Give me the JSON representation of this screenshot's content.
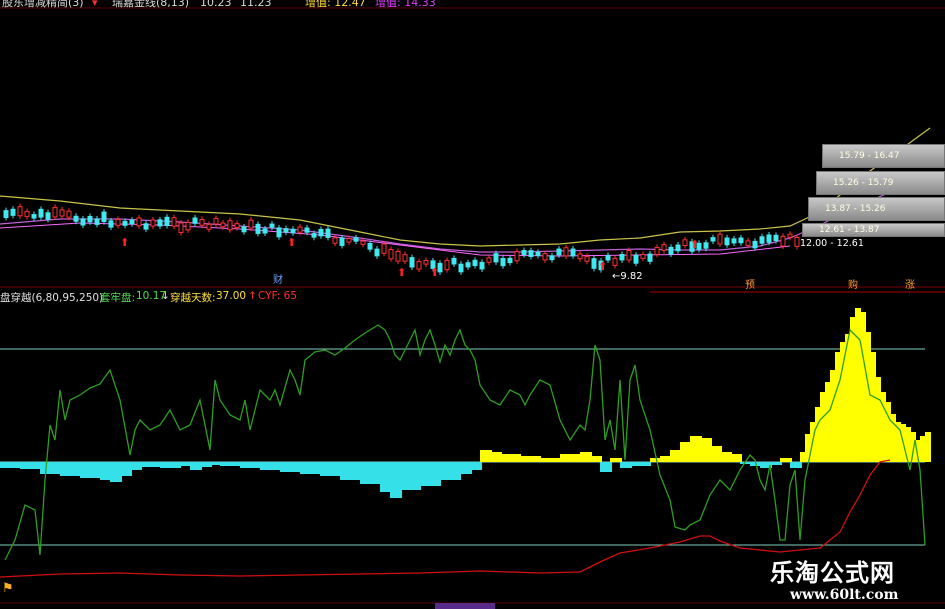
{
  "header": {
    "formula_label": "股东增减精简(3)",
    "ma_label": "瑞嘉金线(8,13)",
    "ma_value": "10.23",
    "ma_value2": "11.23",
    "left_value_label": "增值: 12.47",
    "right_value_label": "增值: 14.33"
  },
  "price_chart": {
    "low_marker": "9.82",
    "zones": [
      {
        "label": "15.79 - 16.47"
      },
      {
        "label": "15.26 - 15.79"
      },
      {
        "label": "13.87 - 15.26"
      },
      {
        "label": "12.61 - 13.87"
      },
      {
        "label": "12.00 - 12.61"
      }
    ],
    "event_marker": "财",
    "signal_tags": [
      "预",
      "购",
      "涨"
    ]
  },
  "indicator": {
    "name": "盘穿越(6,80,95,250)",
    "cost_label": "套牢盘: ",
    "cost_value": "10.17",
    "cost_arrow": "↓",
    "days_label": "穿越天数: ",
    "days_value": "37.00",
    "days_arrow": "↑",
    "cyf_label": "CYF: 65",
    "colors": {
      "yellow": "#ffff00",
      "cyan": "#36e0e8",
      "green": "#2e9e22",
      "red": "#d01010",
      "level": "#7fd0c0"
    }
  },
  "watermark": {
    "site_name": "乐淘公式网",
    "url": "www.60lt.com"
  }
}
